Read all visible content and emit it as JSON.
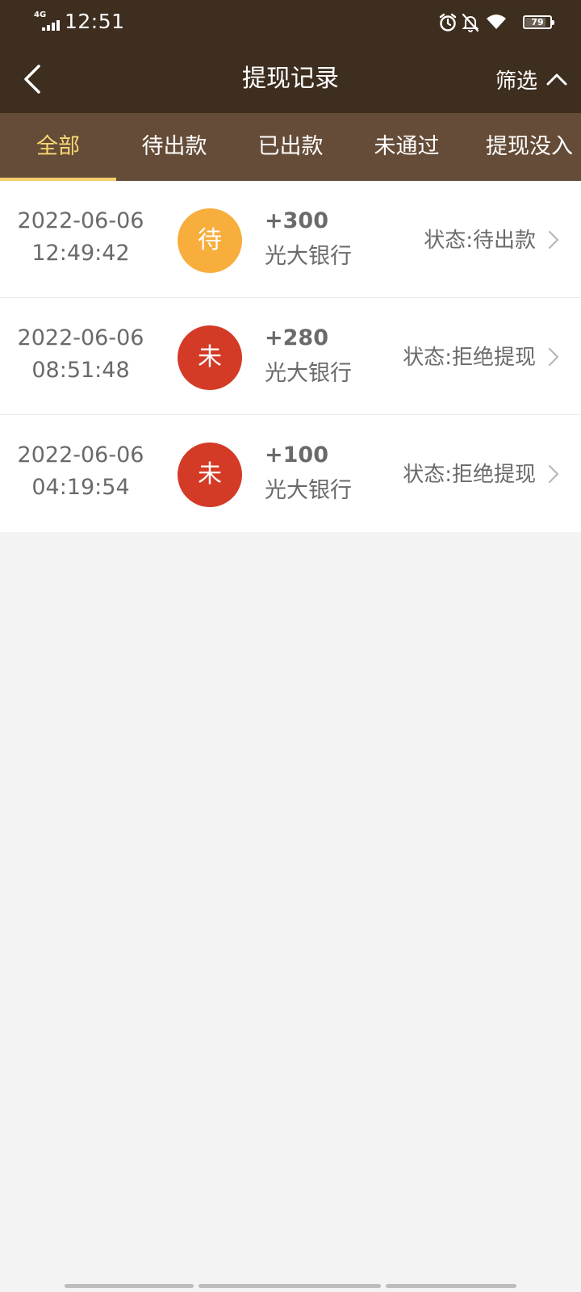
{
  "status_bar": {
    "network": "4G",
    "time": "12:51",
    "battery": "79",
    "battery_level": 0.79
  },
  "header": {
    "title": "提现记录",
    "filter_label": "筛选"
  },
  "tabs": [
    {
      "label": "全部",
      "active": true
    },
    {
      "label": "待出款",
      "active": false
    },
    {
      "label": "已出款",
      "active": false
    },
    {
      "label": "未通过",
      "active": false
    },
    {
      "label": "提现没入",
      "active": false
    }
  ],
  "records": [
    {
      "date": "2022-06-06",
      "time": "12:49:42",
      "badge": "待",
      "badge_color": "#f7ae3d",
      "amount": "+300",
      "bank": "光大银行",
      "status": "状态:待出款"
    },
    {
      "date": "2022-06-06",
      "time": "08:51:48",
      "badge": "未",
      "badge_color": "#d33b27",
      "amount": "+280",
      "bank": "光大银行",
      "status": "状态:拒绝提现"
    },
    {
      "date": "2022-06-06",
      "time": "04:19:54",
      "badge": "未",
      "badge_color": "#d33b27",
      "amount": "+100",
      "bank": "光大银行",
      "status": "状态:拒绝提现"
    }
  ],
  "colors": {
    "header_bg": "#3e2e1f",
    "tab_bg": "#654c38",
    "tab_active": "#f7d775",
    "page_bg": "#f3f3f3"
  }
}
